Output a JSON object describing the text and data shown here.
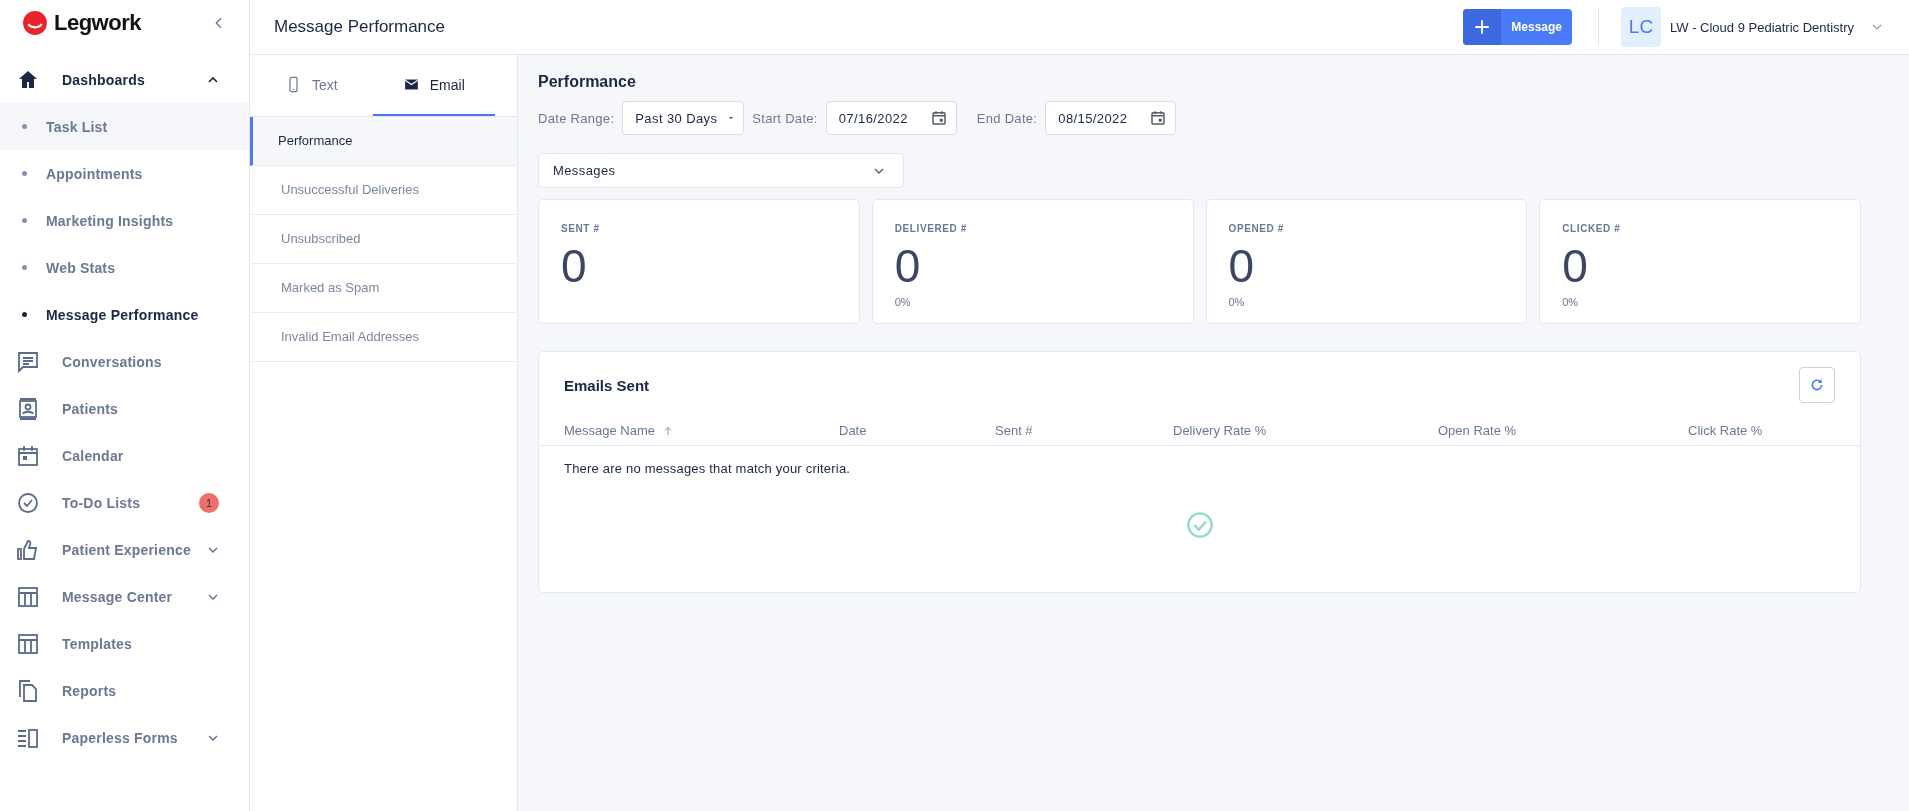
{
  "sidebar": {
    "logo": "Legwork",
    "items": [
      {
        "label": "Dashboards",
        "expanded": true,
        "children": [
          {
            "label": "Task List",
            "hovered": true,
            "selected": false
          },
          {
            "label": "Appointments",
            "hovered": false,
            "selected": false
          },
          {
            "label": "Marketing Insights",
            "hovered": false,
            "selected": false
          },
          {
            "label": "Web Stats",
            "hovered": false,
            "selected": false
          },
          {
            "label": "Message Performance",
            "hovered": false,
            "selected": true
          }
        ]
      },
      {
        "label": "Conversations"
      },
      {
        "label": "Patients"
      },
      {
        "label": "Calendar"
      },
      {
        "label": "To-Do Lists",
        "badge": "1"
      },
      {
        "label": "Patient Experience",
        "expanded": false
      },
      {
        "label": "Message Center",
        "expanded": false
      },
      {
        "label": "Templates"
      },
      {
        "label": "Reports"
      },
      {
        "label": "Paperless Forms",
        "expanded": false
      }
    ]
  },
  "header": {
    "title": "Message Performance",
    "new_button": "Message",
    "account": {
      "initials": "LC",
      "name": "LW - Cloud 9 Pediatric Dentistry"
    }
  },
  "subnav": {
    "tabs": [
      {
        "label": "Text",
        "selected": false
      },
      {
        "label": "Email",
        "selected": true
      }
    ],
    "items": [
      {
        "label": "Performance",
        "selected": true
      },
      {
        "label": "Unsuccessful Deliveries",
        "selected": false
      },
      {
        "label": "Unsubscribed",
        "selected": false
      },
      {
        "label": "Marked as Spam",
        "selected": false
      },
      {
        "label": "Invalid Email Addresses",
        "selected": false
      }
    ]
  },
  "performance": {
    "title": "Performance",
    "filters": {
      "date_range_label": "Date Range:",
      "date_range": "Past 30 Days",
      "start_label": "Start Date:",
      "start_date": "07/16/2022",
      "end_label": "End Date:",
      "end_date": "08/15/2022",
      "type": "Messages"
    },
    "stats": [
      {
        "label": "SENT #",
        "value": "0"
      },
      {
        "label": "DELIVERED #",
        "value": "0",
        "percent": "0%"
      },
      {
        "label": "OPENED #",
        "value": "0",
        "percent": "0%"
      },
      {
        "label": "CLICKED #",
        "value": "0",
        "percent": "0%"
      }
    ],
    "table": {
      "title": "Emails Sent",
      "columns": [
        {
          "label": "Message Name",
          "sorted": true
        },
        {
          "label": "Date",
          "sorted": false
        },
        {
          "label": "Sent #",
          "sorted": false
        },
        {
          "label": "Delivery Rate %",
          "sorted": false
        },
        {
          "label": "Open Rate %",
          "sorted": false
        },
        {
          "label": "Click Rate %",
          "sorted": false
        }
      ],
      "empty_message": "There are no messages that match your criteria."
    }
  }
}
